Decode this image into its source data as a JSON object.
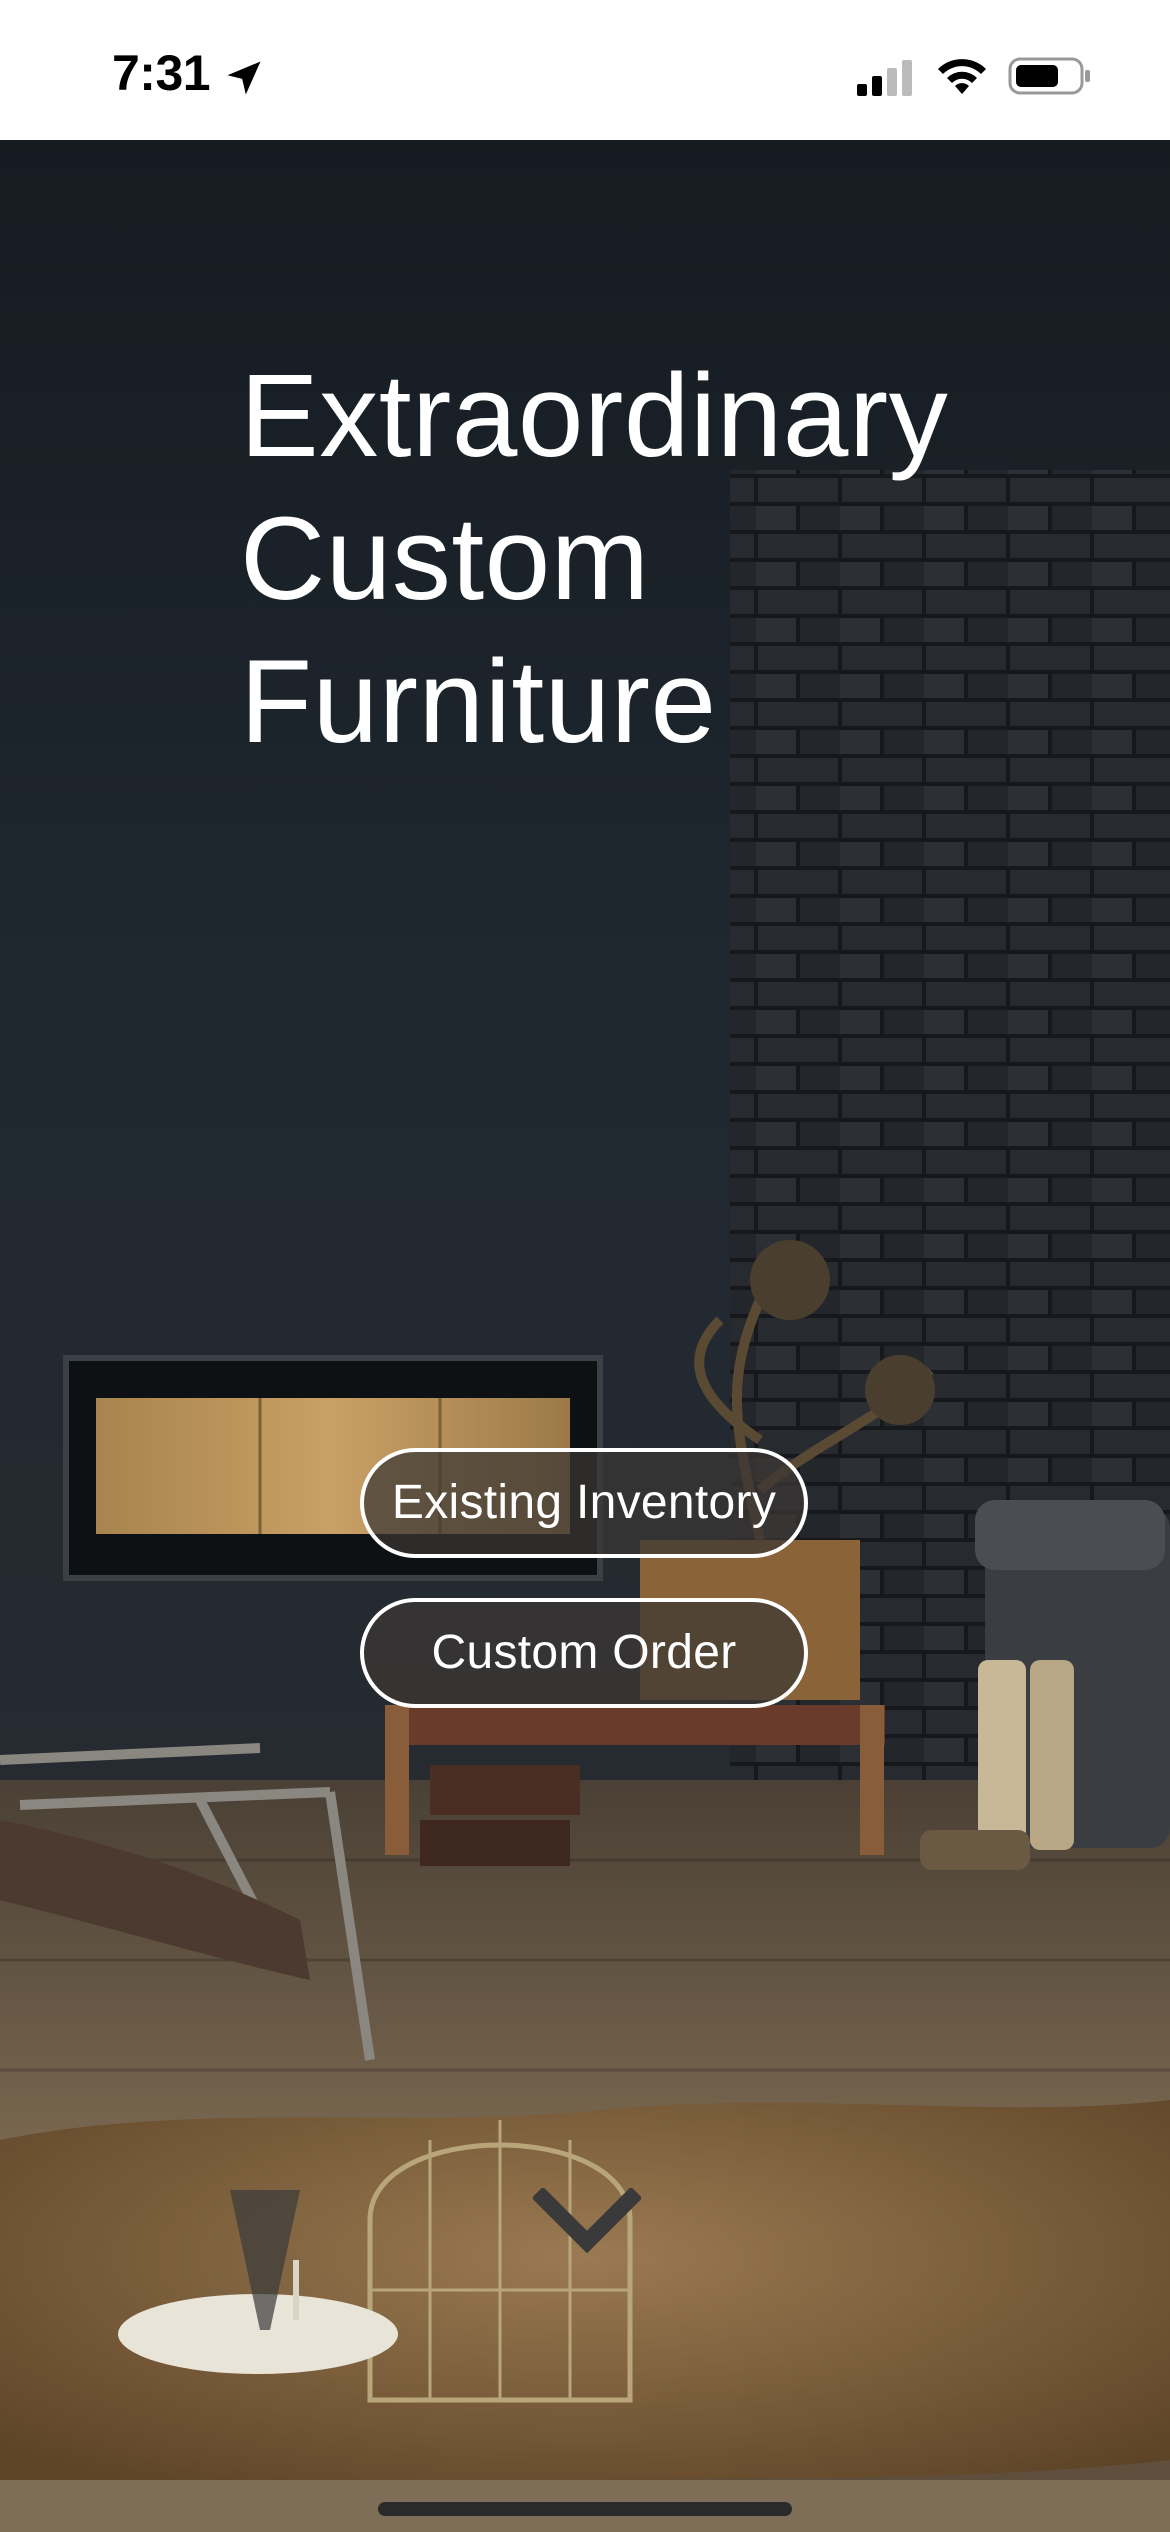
{
  "status_bar": {
    "time": "7:31",
    "icons": [
      "location-arrow-icon",
      "cellular-signal-icon",
      "wifi-icon",
      "battery-icon"
    ]
  },
  "hero": {
    "title_lines": [
      "Extraordinary",
      "Custom",
      "Furniture"
    ],
    "buttons": {
      "existing_inventory": "Existing Inventory",
      "custom_order": "Custom Order"
    },
    "scroll_icon": "chevron-down-icon"
  },
  "colors": {
    "status_bar_bg": "#ffffff",
    "title_text": "#ffffff",
    "button_border": "#ffffff",
    "button_fill": "#3c3734",
    "wall_dark": "#1c232a",
    "brick": "#2b2f34",
    "floor": "#6b5a44",
    "rug": "#8a6a45"
  }
}
